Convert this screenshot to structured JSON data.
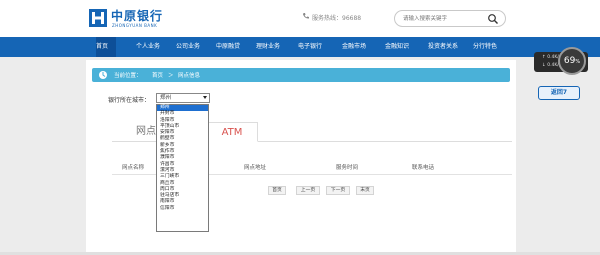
{
  "header": {
    "logo_cn": "中原银行",
    "logo_en": "ZHONGYUAN BANK",
    "hotline": "服务热线：96688",
    "search_placeholder": "请输入搜索关键字"
  },
  "nav": {
    "items": [
      {
        "label": "首页"
      },
      {
        "label": "个人业务"
      },
      {
        "label": "公司业务"
      },
      {
        "label": "中原融贷"
      },
      {
        "label": "理财业务"
      },
      {
        "label": "电子银行"
      },
      {
        "label": "金融市场"
      },
      {
        "label": "金融知识"
      },
      {
        "label": "投资者关系"
      },
      {
        "label": "分行特色"
      }
    ]
  },
  "widgets": {
    "speed_up": "↑ 0.4K/s",
    "speed_down": "↓ 0.4K/s",
    "percent": "69",
    "percent_unit": "%",
    "back_label": "返回7"
  },
  "breadcrumb": {
    "prefix": "当前位置：",
    "home": "首页",
    "sep": "＞",
    "current": "网点信息"
  },
  "city_filter": {
    "label": "银行所在城市：",
    "selected": "郑州",
    "options": [
      "郑州",
      "开封市",
      "洛阳市",
      "平顶山市",
      "安阳市",
      "鹤壁市",
      "新乡市",
      "焦作市",
      "濮阳市",
      "许昌市",
      "漯河市",
      "三门峡市",
      "商丘市",
      "周口市",
      "驻马店市",
      "南阳市",
      "信阳市"
    ]
  },
  "tabs": {
    "branch": "网点",
    "atm": "ATM"
  },
  "table": {
    "headers": [
      "网点名称",
      "网点地址",
      "服务时间",
      "联系电话"
    ]
  },
  "pager": {
    "first": "首页",
    "prev": "上一页",
    "next": "下一页",
    "last": "末页"
  },
  "colors": {
    "brand_blue": "#1565b5",
    "breadcrumb_blue": "#4ab1d8",
    "atm_red": "#d9534f",
    "selection_blue": "#1e6fd0"
  }
}
